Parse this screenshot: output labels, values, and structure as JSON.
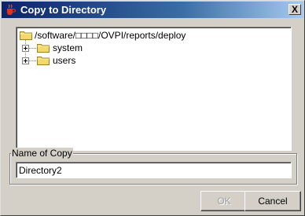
{
  "window": {
    "title": "Copy to Directory",
    "icon": "java-coffee-cup-icon",
    "close_label": "X"
  },
  "tree": {
    "root": {
      "label": "/software/□□□□/OVPI/reports/deploy",
      "icon": "folder-icon"
    },
    "children": [
      {
        "label": "system",
        "icon": "folder-icon",
        "expander": "+"
      },
      {
        "label": "users",
        "icon": "folder-icon",
        "expander": "+"
      }
    ]
  },
  "name_group": {
    "label": "Name of Copy",
    "value": "Directory2"
  },
  "buttons": {
    "ok": "OK",
    "cancel": "Cancel"
  },
  "colors": {
    "titlebar_start": "#0a246a",
    "titlebar_end": "#a6caf0",
    "folder": "#f5d86a",
    "dialog_bg": "#d4d0c8"
  }
}
